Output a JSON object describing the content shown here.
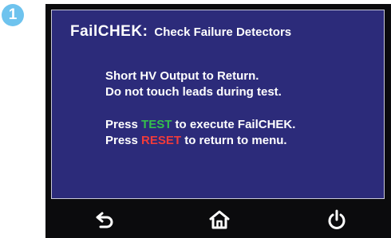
{
  "step_badge": "1",
  "screen": {
    "title": "FailCHEK:",
    "subtitle": "Check Failure Detectors",
    "instructions": [
      "Short  HV  Output to Return.",
      "Do not touch leads during test."
    ],
    "prompt_test": {
      "prefix": "Press ",
      "key": "TEST",
      "suffix": " to execute FailCHEK."
    },
    "prompt_reset": {
      "prefix": "Press ",
      "key": "RESET",
      "suffix": " to return to menu."
    }
  },
  "nav": {
    "back_icon": "back-arrow-icon",
    "home_icon": "home-icon",
    "power_icon": "power-icon"
  },
  "colors": {
    "screen_bg": "#2c2b7a",
    "test_key": "#34c04c",
    "reset_key": "#f03b3b",
    "badge": "#6ec3ee"
  }
}
